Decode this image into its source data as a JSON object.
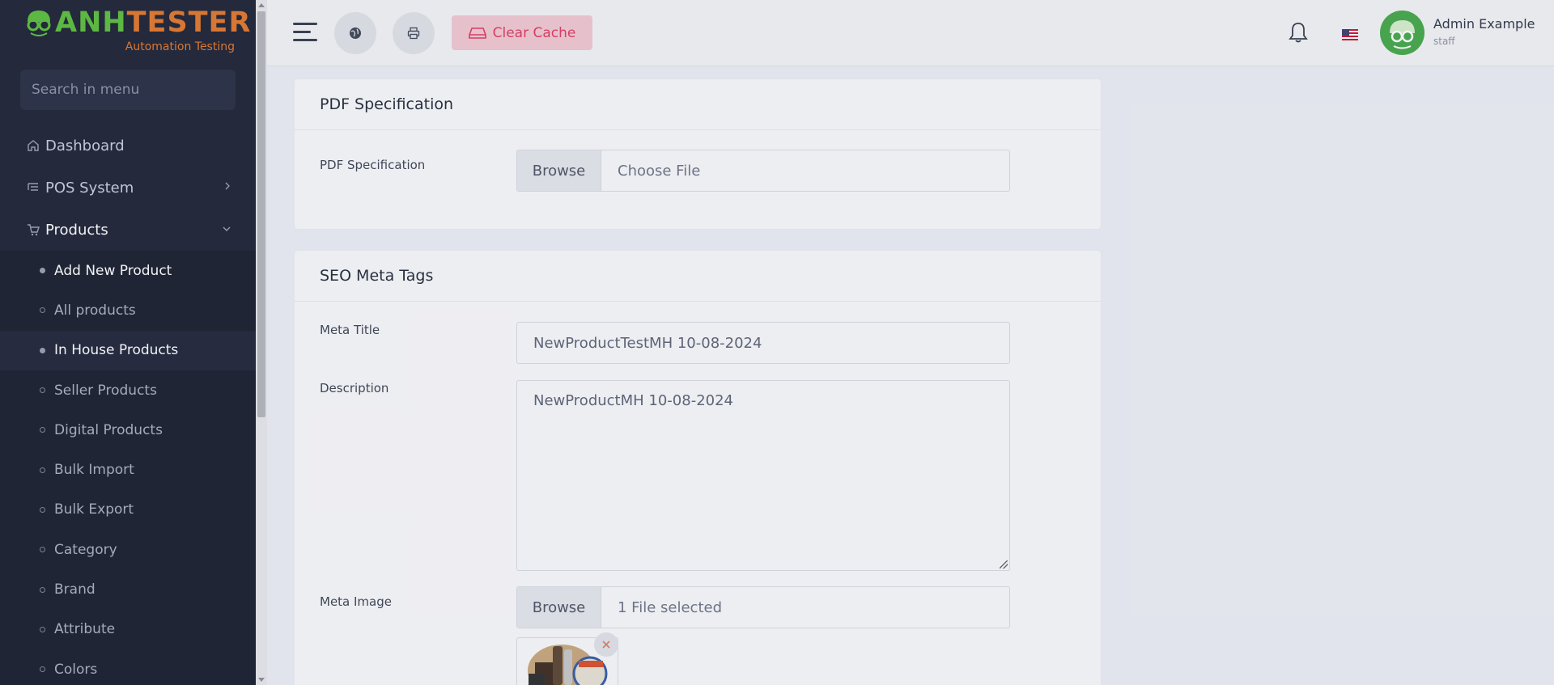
{
  "brand": {
    "name_green": "ANH",
    "name_orange": "TESTER",
    "tagline": "Automation Testing"
  },
  "search": {
    "placeholder": "Search in menu"
  },
  "nav": {
    "dashboard": "Dashboard",
    "pos": "POS System",
    "products": "Products"
  },
  "products_sub": [
    "Add New Product",
    "All products",
    "In House Products",
    "Seller Products",
    "Digital Products",
    "Bulk Import",
    "Bulk Export",
    "Category",
    "Brand",
    "Attribute",
    "Colors"
  ],
  "header": {
    "clear_cache": "Clear Cache",
    "user_name": "Admin Example",
    "user_role": "staff"
  },
  "pdf_card": {
    "title": "PDF Specification",
    "label": "PDF Specification",
    "browse": "Browse",
    "file": "Choose File"
  },
  "seo_card": {
    "title": "SEO Meta Tags",
    "meta_title_label": "Meta Title",
    "meta_title_value": "NewProductTestMH 10-08-2024",
    "description_label": "Description",
    "description_value": "NewProductMH 10-08-2024",
    "meta_image_label": "Meta Image",
    "browse": "Browse",
    "file": "1 File selected"
  },
  "colors": {
    "sidebar_bg": "#1b2033",
    "accent_green": "#5bbf3a",
    "accent_orange": "#e2772a",
    "cache_text": "#e1375f"
  }
}
